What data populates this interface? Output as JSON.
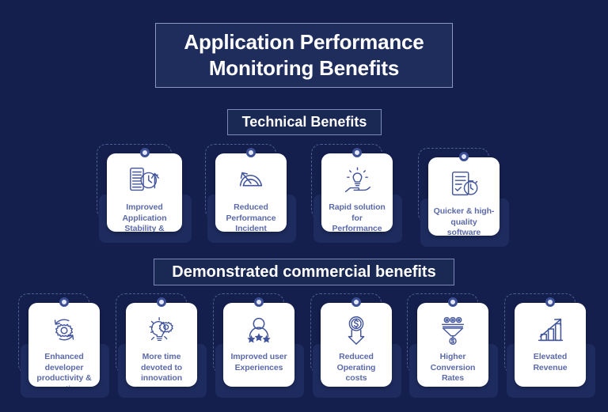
{
  "header": {
    "title_lines": [
      "Application Performance",
      "Monitoring Benefits"
    ]
  },
  "sections": [
    {
      "id": "technical",
      "heading": "Technical Benefits",
      "cards": [
        {
          "label": "Improved Application Stability & Uptime",
          "icon": "server-clock-uptime-icon"
        },
        {
          "label": "Reduced Performance Incident",
          "icon": "declining-gauge-arrow-icon"
        },
        {
          "label": "Rapid solution for Performance problem",
          "icon": "hand-lightbulb-icon"
        },
        {
          "label": "Quicker & high-quality software release",
          "icon": "document-stopwatch-icon"
        }
      ]
    },
    {
      "id": "commercial",
      "heading": "Demonstrated commercial benefits",
      "cards": [
        {
          "label": "Enhanced developer productivity & operations",
          "icon": "gear-cycle-devops-icon"
        },
        {
          "label": "More time devoted to innovation",
          "icon": "lightbulb-gears-icon"
        },
        {
          "label": "Improved user Experiences",
          "icon": "user-stars-rating-icon"
        },
        {
          "label": "Reduced Operating costs",
          "icon": "dollar-coin-down-arrow-icon"
        },
        {
          "label": "Higher Conversion Rates",
          "icon": "conversion-funnel-icon"
        },
        {
          "label": "Elevated Revenue",
          "icon": "bar-chart-growth-arrow-icon"
        }
      ]
    }
  ],
  "colors": {
    "background": "#141f4d",
    "panel": "#1e2d5c",
    "card": "#ffffff",
    "card_text": "#5c6ba8",
    "icon_stroke": "#41549c",
    "dot": "#3c4f95",
    "dashed_outline": "#4d5c92"
  }
}
